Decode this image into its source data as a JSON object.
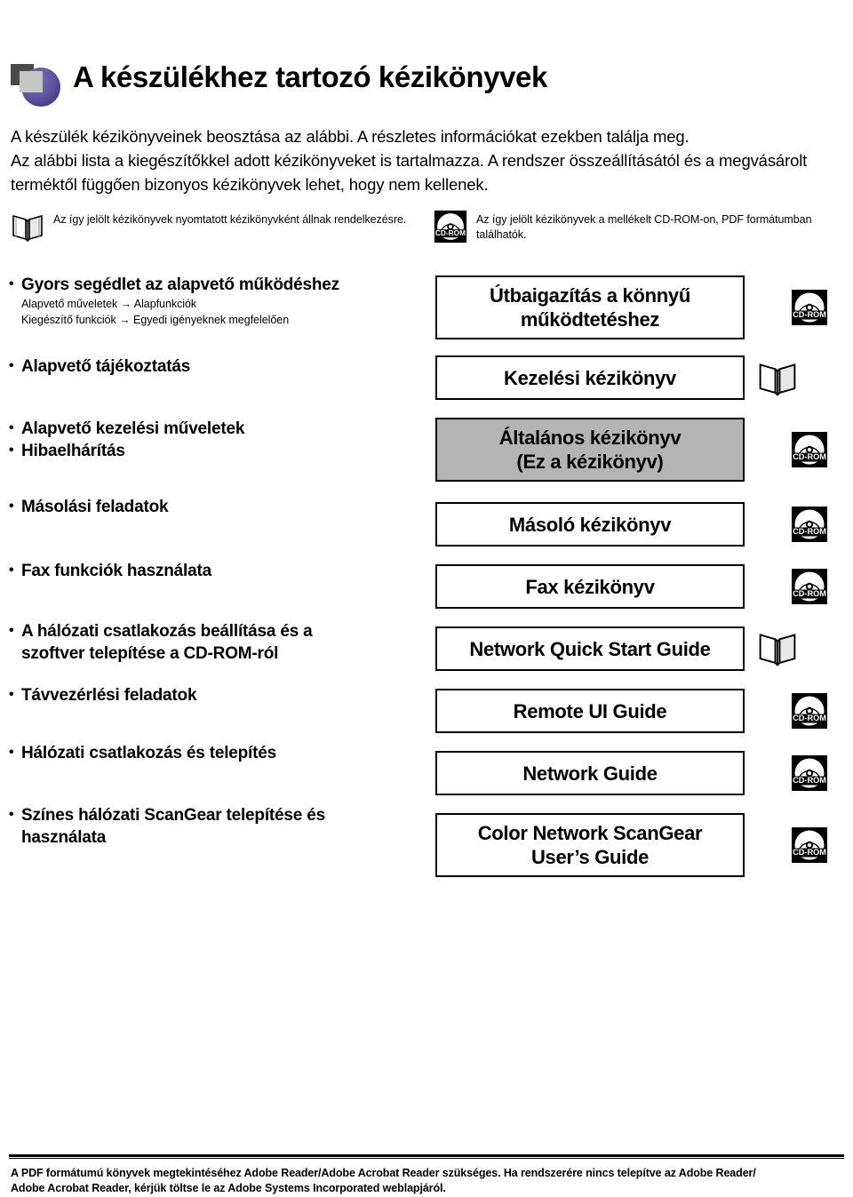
{
  "header": {
    "title": "A készülékhez tartozó kézikönyvek",
    "logo_icon": "purple-circle-squares-logo-icon",
    "logo_colors": {
      "circle": "#5d55a0",
      "dark_square": "#4a4a4a",
      "light_square": "#c6c6c6"
    }
  },
  "intro": {
    "paragraphs": [
      "A készülék kézikönyveinek beosztása az alábbi. A részletes információkat ezekben találja meg.",
      "Az alábbi lista a kiegészítőkkel adott kézikönyveket is tartalmazza. A rendszer összeállításától és a megvásárolt terméktől függően bizonyos kézikönyvek lehet, hogy nem kellenek."
    ]
  },
  "legend": {
    "printed": {
      "icon": "open-book-icon",
      "text": "Az így jelölt kézikönyvek nyomtatott kézikönyvként állnak rendelkezésre."
    },
    "cdrom": {
      "icon": "cd-rom-icon",
      "icon_label": "CD-ROM",
      "text": "Az így jelölt kézikönyvek a mellékelt CD-ROM-on, PDF formátumban találhatók."
    }
  },
  "map": {
    "rows": [
      {
        "topic": "Gyors segédlet az alapvető működéshez",
        "sublines": [
          "Alapvető műveletek → Alapfunkciók",
          "Kiegészítő funkciók → Egyedi igényeknek megfelelően"
        ],
        "manual": "Útbaigazítás a könnyű működtetéshez",
        "media": "cd-rom-icon",
        "media_label": "CD-ROM",
        "shaded": false
      },
      {
        "topic": "Alapvető tájékoztatás",
        "sublines": [],
        "manual": "Kezelési kézikönyv",
        "media": "open-book-icon",
        "media_label": "",
        "shaded": false
      },
      {
        "topic": "Alapvető kezelési műveletek",
        "topic2": "Hibaelhárítás",
        "sublines": [],
        "manual": "Általános kézikönyv",
        "manual2": "(Ez a kézikönyv)",
        "media": "cd-rom-icon",
        "media_label": "CD-ROM",
        "shaded": true
      },
      {
        "topic": "Másolási feladatok",
        "sublines": [],
        "manual": "Másoló kézikönyv",
        "media": "cd-rom-icon",
        "media_label": "CD-ROM",
        "shaded": false
      },
      {
        "topic": "Fax funkciók használata",
        "sublines": [],
        "manual": "Fax kézikönyv",
        "media": "cd-rom-icon",
        "media_label": "CD-ROM",
        "shaded": false
      },
      {
        "topic": "A hálózati csatlakozás beállítása és a szoftver telepítése a CD-ROM-ról",
        "sublines": [],
        "manual": "Network Quick Start Guide",
        "media": "open-book-icon",
        "media_label": "",
        "shaded": false
      },
      {
        "topic": "Távvezérlési feladatok",
        "sublines": [],
        "manual": "Remote UI Guide",
        "media": "cd-rom-icon",
        "media_label": "CD-ROM",
        "shaded": false
      },
      {
        "topic": "Hálózati csatlakozás és telepítés",
        "sublines": [],
        "manual": "Network Guide",
        "media": "cd-rom-icon",
        "media_label": "CD-ROM",
        "shaded": false
      },
      {
        "topic": "Színes hálózati ScanGear telepítése és használata",
        "sublines": [],
        "manual": "Color Network ScanGear",
        "manual2": "User’s Guide",
        "media": "cd-rom-icon",
        "media_label": "CD-ROM",
        "shaded": false
      }
    ]
  },
  "footer": {
    "lines": [
      "A PDF formátumú könyvek megtekintéséhez Adobe Reader/Adobe Acrobat Reader szükséges. Ha rendszerére nincs telepítve az Adobe Reader/",
      "Adobe Acrobat Reader, kérjük töltse le az Adobe Systems Incorporated weblapjáról."
    ]
  }
}
